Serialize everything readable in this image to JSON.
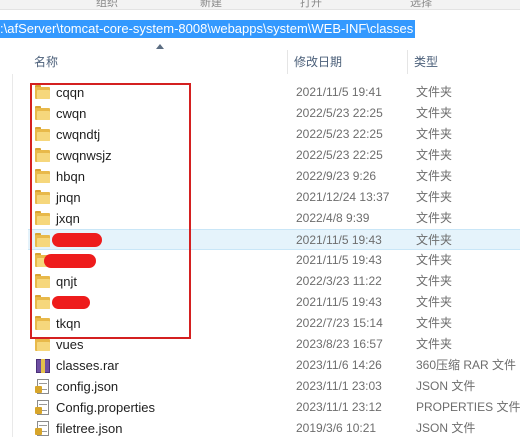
{
  "ribbon": {
    "groups": [
      "组织",
      "新建",
      "打开",
      "选择"
    ]
  },
  "address_bar": {
    "path": ":\\afServer\\tomcat-core-system-8008\\webapps\\system\\WEB-INF\\classes"
  },
  "columns": {
    "name": "名称",
    "date": "修改日期",
    "type": "类型"
  },
  "files": [
    {
      "name": "cqqn",
      "date": "2021/11/5 19:41",
      "type": "文件夹",
      "icon": "folder-icon"
    },
    {
      "name": "cwqn",
      "date": "2022/5/23 22:25",
      "type": "文件夹",
      "icon": "folder-icon"
    },
    {
      "name": "cwqndtj",
      "date": "2022/5/23 22:25",
      "type": "文件夹",
      "icon": "folder-icon"
    },
    {
      "name": "cwqnwsjz",
      "date": "2022/5/23 22:25",
      "type": "文件夹",
      "icon": "folder-icon"
    },
    {
      "name": "hbqn",
      "date": "2022/9/23 9:26",
      "type": "文件夹",
      "icon": "folder-icon"
    },
    {
      "name": "jnqn",
      "date": "2021/12/24 13:37",
      "type": "文件夹",
      "icon": "folder-icon"
    },
    {
      "name": "jxqn",
      "date": "2022/4/8 9:39",
      "type": "文件夹",
      "icon": "folder-icon"
    },
    {
      "name": "",
      "date": "2021/11/5 19:43",
      "type": "文件夹",
      "icon": "folder-icon",
      "selected": true
    },
    {
      "name": "",
      "date": "2021/11/5 19:43",
      "type": "文件夹",
      "icon": "folder-icon"
    },
    {
      "name": "qnjt",
      "date": "2022/3/23 11:22",
      "type": "文件夹",
      "icon": "folder-icon"
    },
    {
      "name": "",
      "date": "2021/11/5 19:43",
      "type": "文件夹",
      "icon": "folder-icon"
    },
    {
      "name": "tkqn",
      "date": "2022/7/23 15:14",
      "type": "文件夹",
      "icon": "folder-icon"
    },
    {
      "name": "vues",
      "date": "2023/8/23 16:57",
      "type": "文件夹",
      "icon": "folder-icon"
    },
    {
      "name": "classes.rar",
      "date": "2023/11/6 14:26",
      "type": "360压缩 RAR 文件",
      "icon": "archive-icon"
    },
    {
      "name": "config.json",
      "date": "2023/11/1 23:03",
      "type": "JSON 文件",
      "icon": "document-icon"
    },
    {
      "name": "Config.properties",
      "date": "2023/11/1 23:12",
      "type": "PROPERTIES 文件",
      "icon": "document-icon"
    },
    {
      "name": "filetree.json",
      "date": "2019/3/6 10:21",
      "type": "JSON 文件",
      "icon": "document-icon"
    }
  ],
  "colors": {
    "selection": "#3399ff",
    "annotation": "#d42020",
    "folder": "#e8b94a"
  }
}
